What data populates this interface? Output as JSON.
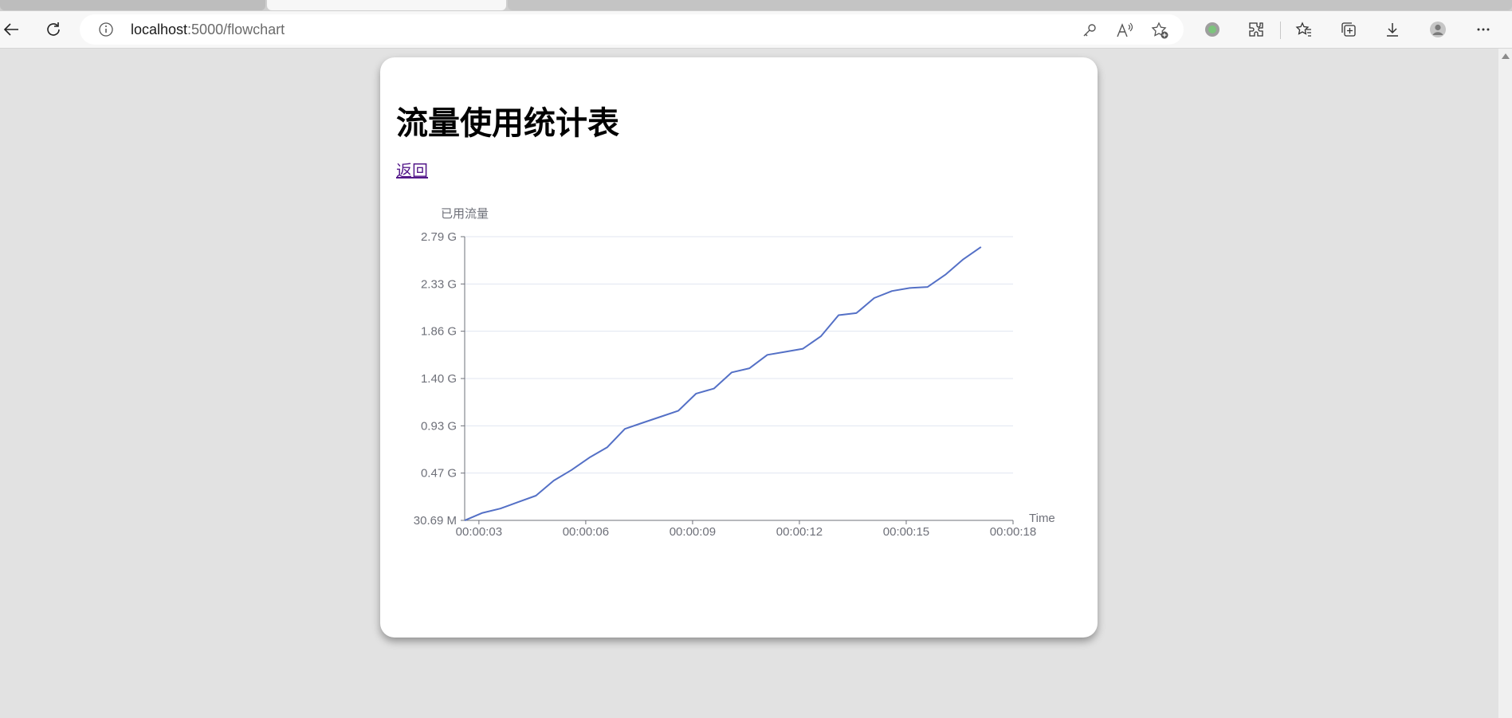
{
  "browser": {
    "url_host": "localhost",
    "url_rest": ":5000/flowchart"
  },
  "page": {
    "title": "流量使用统计表",
    "back_link": "返回"
  },
  "colors": {
    "line": "#5470c6",
    "axis": "#6e7079",
    "grid": "#e0e6f1"
  },
  "chart_data": {
    "type": "line",
    "ylabel": "已用流量",
    "xlabel": "Time",
    "y_ticks": [
      "30.69 M",
      "0.47 G",
      "0.93 G",
      "1.40 G",
      "1.86 G",
      "2.33 G",
      "2.79 G"
    ],
    "y_tick_values_gb": [
      0.03069,
      0.47,
      0.93,
      1.4,
      1.86,
      2.33,
      2.79
    ],
    "x_ticks": [
      "00:00:03",
      "00:00:06",
      "00:00:09",
      "00:00:12",
      "00:00:15",
      "00:00:18"
    ],
    "x_tick_seconds": [
      3,
      6,
      9,
      12,
      15,
      18
    ],
    "xlim_seconds": [
      2.6,
      18
    ],
    "ylim_gb": [
      0.03069,
      2.79
    ],
    "grid": true,
    "series": [
      {
        "x_seconds": [
          2.6,
          3.1,
          3.6,
          4.1,
          4.6,
          5.1,
          5.6,
          6.1,
          6.6,
          7.1,
          7.6,
          8.1,
          8.6,
          9.1,
          9.6,
          10.1,
          10.6,
          11.1,
          11.6,
          12.1,
          12.6,
          13.1,
          13.6,
          13.7,
          14.1,
          14.6,
          15.1,
          15.6,
          16.1,
          16.6,
          17.1
        ],
        "y_gb": [
          0.03,
          0.1,
          0.14,
          0.2,
          0.26,
          0.4,
          0.5,
          0.62,
          0.72,
          0.9,
          0.96,
          1.02,
          1.08,
          1.25,
          1.3,
          1.46,
          1.5,
          1.63,
          1.66,
          1.69,
          1.81,
          2.02,
          2.04,
          2.07,
          2.19,
          2.26,
          2.29,
          2.3,
          2.42,
          2.57,
          2.69
        ]
      }
    ]
  }
}
